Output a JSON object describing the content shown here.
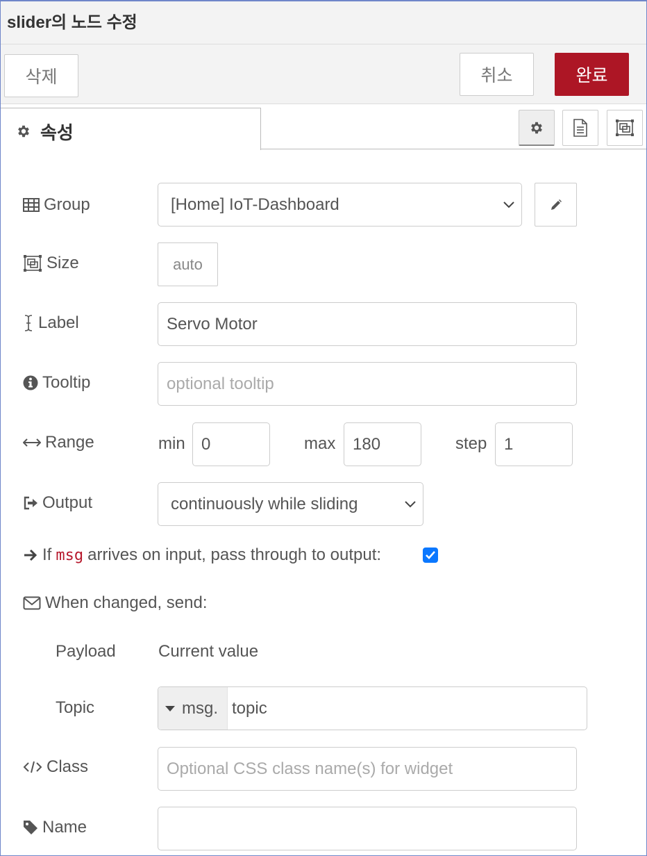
{
  "dialog": {
    "title": "slider의 노드 수정",
    "delete_label": "삭제",
    "cancel_label": "취소",
    "done_label": "완료",
    "tab_label": "속성"
  },
  "form": {
    "group": {
      "label": "Group",
      "value": "[Home] IoT-Dashboard"
    },
    "size": {
      "label": "Size",
      "value": "auto"
    },
    "label": {
      "label": "Label",
      "value": "Servo Motor"
    },
    "tooltip": {
      "label": "Tooltip",
      "placeholder": "optional tooltip"
    },
    "range": {
      "label": "Range",
      "min_label": "min",
      "min_value": "0",
      "max_label": "max",
      "max_value": "180",
      "step_label": "step",
      "step_value": "1"
    },
    "output": {
      "label": "Output",
      "value": "continuously while sliding"
    },
    "passthru": {
      "text_before": "If",
      "code": "msg",
      "text_after": "arrives on input, pass through to output:",
      "checked": true
    },
    "when_changed": {
      "label": "When changed, send:"
    },
    "payload": {
      "label": "Payload",
      "value": "Current value"
    },
    "topic": {
      "label": "Topic",
      "prefix": "msg.",
      "value": "topic"
    },
    "class": {
      "label": "Class",
      "placeholder": "Optional CSS class name(s) for widget"
    },
    "name": {
      "label": "Name",
      "value": ""
    }
  },
  "colors": {
    "accent": "#ad1625",
    "checkbox": "#0b78ff",
    "code": "#b6182c"
  }
}
